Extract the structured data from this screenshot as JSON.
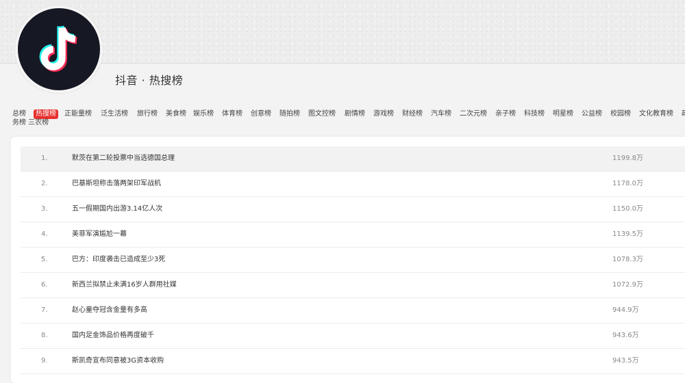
{
  "header": {
    "title": "抖音 · 热搜榜",
    "logo": "tiktok-logo",
    "colors": {
      "logo_bg": "#161823",
      "logo_cyan": "#25f4ee",
      "logo_red": "#fe2c55",
      "active_tab": "#e8312f"
    }
  },
  "tabs": {
    "items": [
      {
        "label": "总榜"
      },
      {
        "label": "热搜榜"
      },
      {
        "label": "正能量榜"
      },
      {
        "label": "泛生活榜"
      },
      {
        "label": "旅行榜"
      },
      {
        "label": "美食榜"
      },
      {
        "label": "娱乐榜"
      },
      {
        "label": "体育榜"
      },
      {
        "label": "创意榜"
      },
      {
        "label": "随拍榜"
      },
      {
        "label": "图文控榜"
      },
      {
        "label": "剧情榜"
      },
      {
        "label": "游戏榜"
      },
      {
        "label": "财经榜"
      },
      {
        "label": "汽车榜"
      },
      {
        "label": "二次元榜"
      },
      {
        "label": "亲子榜"
      },
      {
        "label": "科技榜"
      },
      {
        "label": "明星榜"
      },
      {
        "label": "公益榜"
      },
      {
        "label": "校园榜"
      },
      {
        "label": "文化教育榜"
      },
      {
        "label": "政"
      }
    ],
    "active": "热搜榜",
    "wrapped_text": "务榜  三农榜"
  },
  "list": {
    "rows": [
      {
        "rank": "1.",
        "title": "默茨在第二轮投票中当选德国总理",
        "heat": "1199.8万"
      },
      {
        "rank": "2.",
        "title": "巴基斯坦称击落两架印军战机",
        "heat": "1178.0万"
      },
      {
        "rank": "3.",
        "title": "五一假期国内出游3.14亿人次",
        "heat": "1150.0万"
      },
      {
        "rank": "4.",
        "title": "美菲军演尴尬一幕",
        "heat": "1139.5万"
      },
      {
        "rank": "5.",
        "title": "巴方：印度袭击已造成至少3死",
        "heat": "1078.3万"
      },
      {
        "rank": "6.",
        "title": "新西兰拟禁止未满16岁人群用社媒",
        "heat": "1072.9万"
      },
      {
        "rank": "7.",
        "title": "赵心童夺冠含金量有多高",
        "heat": "944.9万"
      },
      {
        "rank": "8.",
        "title": "国内足金饰品价格再度破千",
        "heat": "943.6万"
      },
      {
        "rank": "9.",
        "title": "斯凯奇宣布同意被3G资本收购",
        "heat": "943.5万"
      }
    ]
  }
}
